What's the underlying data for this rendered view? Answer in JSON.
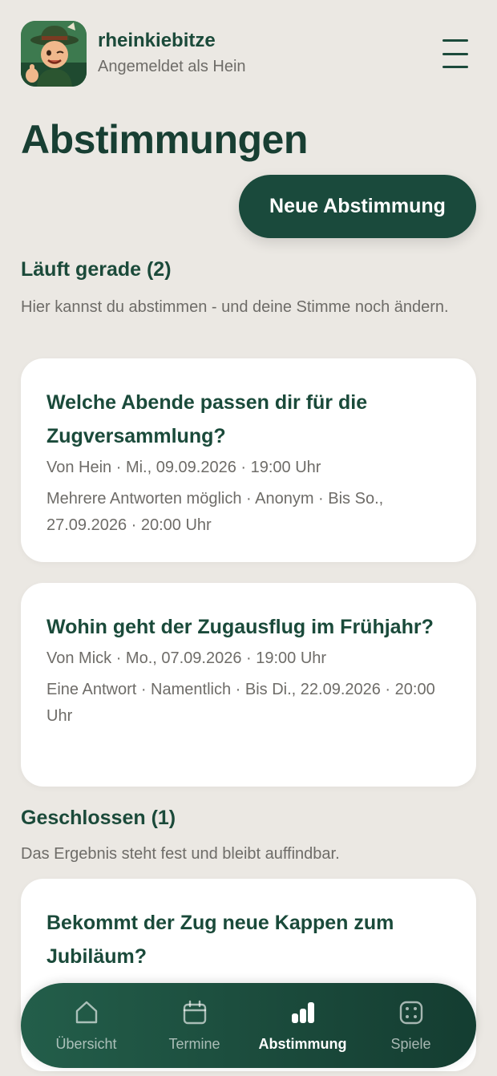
{
  "header": {
    "app_name": "rheinkiebitze",
    "subtitle": "Angemeldet als Hein"
  },
  "page": {
    "title": "Abstimmungen",
    "new_button": "Neue Abstimmung"
  },
  "sections": {
    "open": {
      "title": "Läuft gerade (2)",
      "description": "Hier kannst du abstimmen - und deine Stimme noch ändern."
    },
    "closed": {
      "title": "Geschlossen (1)",
      "description": "Das Ergebnis steht fest und bleibt auffindbar."
    }
  },
  "polls": [
    {
      "title": "Welche Abende passen dir für die Zugversammlung?",
      "meta": "Von Hein · Mi., 09.09.2026 · 19:00 Uhr",
      "details": "Mehrere Antworten möglich · Anonym · Bis So., 27.09.2026 · 20:00 Uhr"
    },
    {
      "title": "Wohin geht der Zugausflug im Frühjahr?",
      "meta": "Von Mick · Mo., 07.09.2026 · 19:00 Uhr",
      "details": "Eine Antwort · Namentlich · Bis Di., 22.09.2026 · 20:00 Uhr"
    },
    {
      "title": "Bekommt der Zug neue Kappen zum Jubiläum?"
    }
  ],
  "nav": {
    "items": [
      {
        "label": "Übersicht",
        "icon": "home-icon"
      },
      {
        "label": "Termine",
        "icon": "calendar-icon"
      },
      {
        "label": "Abstimmung",
        "icon": "bar-chart-icon",
        "active": true
      },
      {
        "label": "Spiele",
        "icon": "dice-icon"
      }
    ]
  },
  "colors": {
    "background": "#ebe8e3",
    "primary": "#1a4a3c",
    "text_muted": "#6e6c68"
  }
}
